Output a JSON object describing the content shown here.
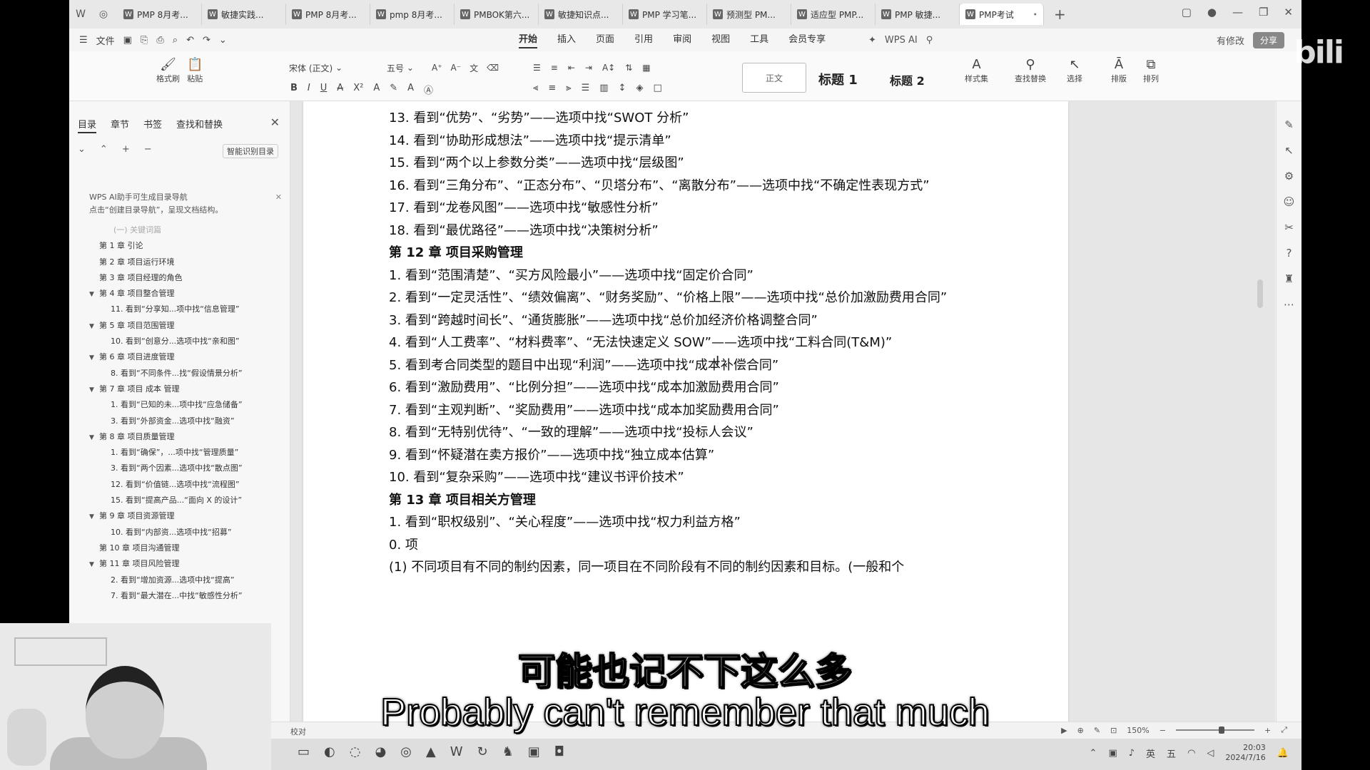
{
  "tabs": [
    {
      "label": "PMP 8月考..."
    },
    {
      "label": "敏捷实践..."
    },
    {
      "label": "PMP 8月考..."
    },
    {
      "label": "pmp 8月考..."
    },
    {
      "label": "PMBOK第六..."
    },
    {
      "label": "敏捷知识点..."
    },
    {
      "label": "PMP 学习笔..."
    },
    {
      "label": "预测型 PM..."
    },
    {
      "label": "适应型 PMP..."
    },
    {
      "label": "PMP 敏捷..."
    },
    {
      "label": "PMP考试"
    }
  ],
  "menu": {
    "file": "文件",
    "tabs": [
      "开始",
      "插入",
      "页面",
      "引用",
      "审阅",
      "视图",
      "工具",
      "会员专享"
    ],
    "wps_ai": "WPS AI",
    "has_changes": "有修改",
    "share": "分享"
  },
  "ribbon": {
    "format_painter": "格式刷",
    "paste": "粘贴",
    "font_name": "宋体 (正文)",
    "font_size": "五号",
    "style_normal": "正文",
    "style_h1": "标题 1",
    "style_h2": "标题 2",
    "style_set": "样式集",
    "find_replace": "查找替换",
    "select": "选择",
    "layout": "排版",
    "arrange": "排列"
  },
  "sidebar": {
    "tabs": [
      "目录",
      "章节",
      "书签",
      "查找和替换"
    ],
    "smart_toc": "智能识别目录",
    "ai_tip_line1": "WPS AI助手可生成目录导航",
    "ai_tip_line2": "点击“创建目录导航”，呈现文档结构。",
    "toc": [
      {
        "level": "faded",
        "label": "(一) 关键词篇"
      },
      {
        "level": "l1",
        "label": "第 1 章 引论"
      },
      {
        "level": "l1",
        "label": "第 2 章 项目运行环境"
      },
      {
        "level": "l1",
        "label": "第 3 章 项目经理的角色"
      },
      {
        "level": "l1exp",
        "label": "第 4 章 项目整合管理"
      },
      {
        "level": "l2",
        "label": "11. 看到“分享知...项中找“信息管理”"
      },
      {
        "level": "l1exp",
        "label": "第 5 章 项目范围管理"
      },
      {
        "level": "l2",
        "label": "10. 看到“创意分...选项中找“亲和图”"
      },
      {
        "level": "l1exp",
        "label": "第 6 章 项目进度管理"
      },
      {
        "level": "l2",
        "label": "8. 看到“不同条件...找“假设情景分析”"
      },
      {
        "level": "l1exp",
        "label": "第 7 章 项目 成本 管理"
      },
      {
        "level": "l2",
        "label": "1. 看到“已知的未...项中找“应急储备”"
      },
      {
        "level": "l2",
        "label": "3. 看到“外部资金...选项中找“融资”"
      },
      {
        "level": "l1exp",
        "label": "第 8 章 项目质量管理"
      },
      {
        "level": "l2",
        "label": "1. 看到“确保”，...项中找“管理质量”"
      },
      {
        "level": "l2",
        "label": "3. 看到“两个因素...选项中找“散点图”"
      },
      {
        "level": "l2",
        "label": "12. 看到“价值链...选项中找“流程图”"
      },
      {
        "level": "l2",
        "label": "15. 看到“提高产品...“面向 X 的设计”"
      },
      {
        "level": "l1exp",
        "label": "第 9 章 项目资源管理"
      },
      {
        "level": "l2",
        "label": "10. 看到“内部资...选项中找“招募”"
      },
      {
        "level": "l1",
        "label": "第 10 章 项目沟通管理"
      },
      {
        "level": "l1exp",
        "label": "第 11 章 项目风险管理"
      },
      {
        "level": "l2",
        "label": "2. 看到“增加资源...选项中找“提高”"
      },
      {
        "level": "l2",
        "label": "7. 看到“最大潜在...中找“敏感性分析”"
      }
    ]
  },
  "doc": {
    "lines_top": [
      "13. 看到“优势”、“劣势”——选项中找“SWOT 分析”",
      "14. 看到“协助形成想法”——选项中找“提示清单”",
      "15. 看到“两个以上参数分类”——选项中找“层级图”",
      "16. 看到“三角分布”、“正态分布”、“贝塔分布”、“离散分布”——选项中找“不确定性表现方式”",
      "17. 看到“龙卷风图”——选项中找“敏感性分析”",
      "18. 看到“最优路径”——选项中找“决策树分析”"
    ],
    "chapter12": "第 12 章 项目采购管理",
    "lines12": [
      "1. 看到“范围清楚”、“买方风险最小”——选项中找“固定价合同”",
      "2. 看到“一定灵活性”、“绩效偏离”、“财务奖励”、“价格上限”——选项中找“总价加激励费用合同”",
      "3. 看到“跨越时间长”、“通货膨胀”——选项中找“总价加经济价格调整合同”",
      "4. 看到“人工费率”、“材料费率”、“无法快速定义 SOW”——选项中找“工料合同(T&M)”",
      "5. 看到考合同类型的题目中出现“利润”——选项中找“成本补偿合同”",
      "6. 看到“激励费用”、“比例分担”——选项中找“成本加激励费用合同”",
      "7. 看到“主观判断”、“奖励费用”——选项中找“成本加奖励费用合同”",
      "8. 看到“无特别优待”、“一致的理解”——选项中找“投标人会议”",
      "9. 看到“怀疑潜在卖方报价”——选项中找“独立成本估算”",
      "10. 看到“复杂采购”——选项中找“建议书评价技术”"
    ],
    "chapter13": "第 13 章 项目相关方管理",
    "lines13": [
      "1. 看到“职权级别”、“关心程度”——选项中找“权力利益方格”"
    ],
    "sec0": "0. 项",
    "last_line": "(1) 不同项目有不同的制约因素，同一项目在不同阶段有不同的制约因素和目标。(一般和个"
  },
  "status": {
    "proofread": "校对",
    "zoom": "150%"
  },
  "taskbar": {
    "ime": "英",
    "ime2": "五",
    "time": "20:03",
    "date": "2024/7/16"
  },
  "subtitles": {
    "cn": "可能也记不下这么多",
    "en": "Probably can't remember that much"
  },
  "watermark": "bili"
}
